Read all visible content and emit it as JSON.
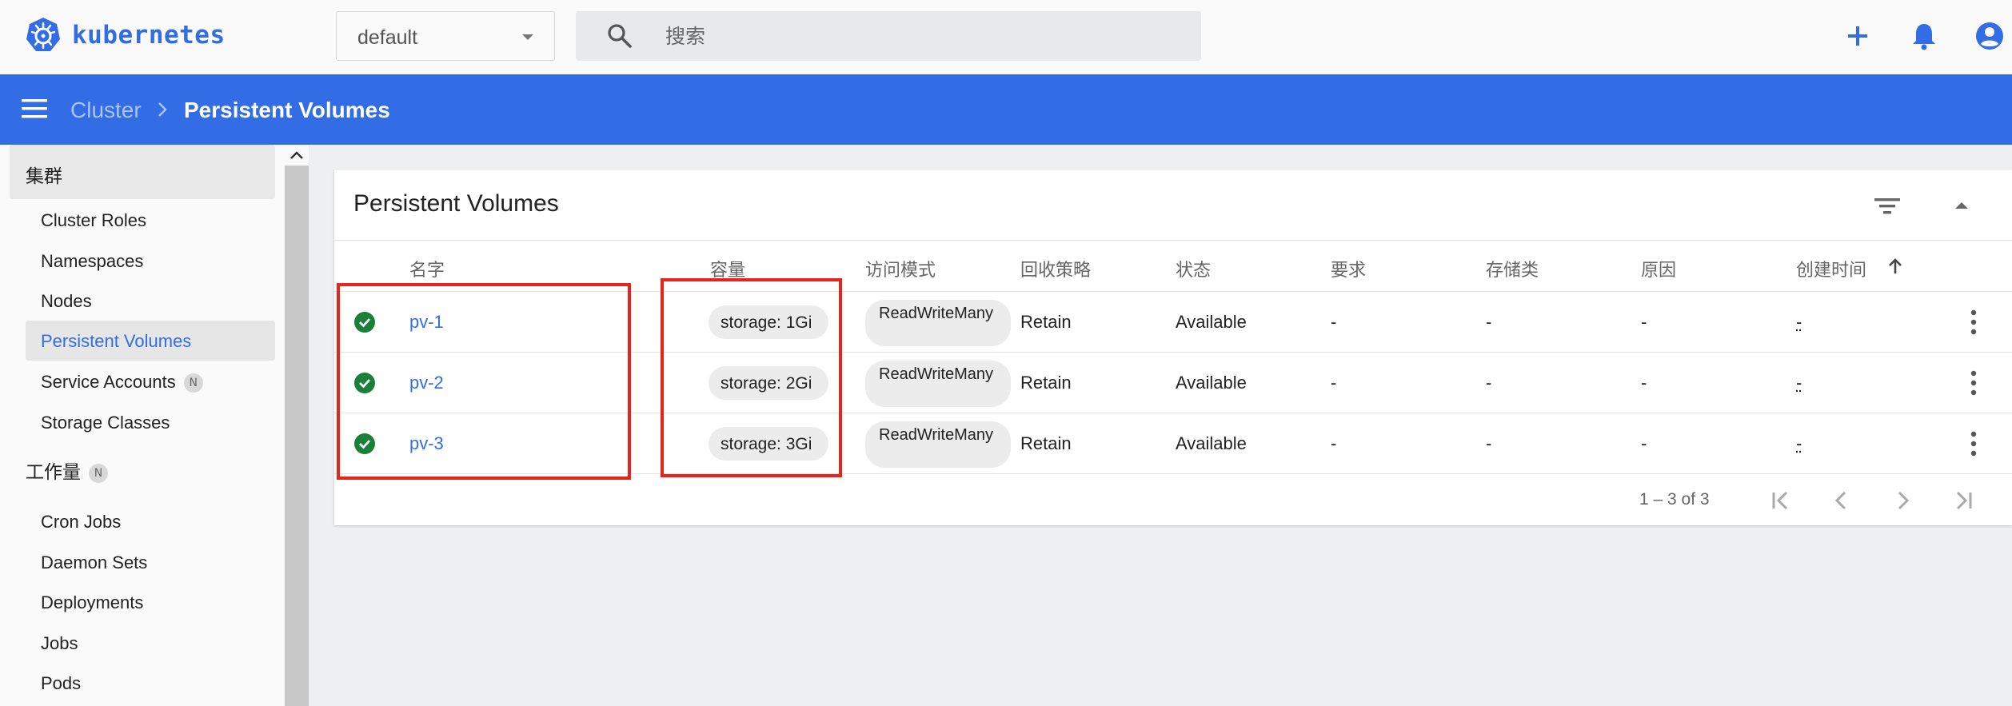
{
  "topbar": {
    "brand": "kubernetes",
    "namespace_value": "default",
    "search_placeholder": "搜索",
    "icons": [
      "kubernetes-logo-icon",
      "search-icon",
      "plus-icon",
      "bell-icon",
      "account-icon"
    ],
    "brand_color": "#326de6"
  },
  "breadcrumb": {
    "parent": "Cluster",
    "current": "Persistent Volumes",
    "bar_color": "#326de6"
  },
  "sidebar": {
    "groups": [
      {
        "label": "集群",
        "items": [
          {
            "label": "Cluster Roles"
          },
          {
            "label": "Namespaces"
          },
          {
            "label": "Nodes"
          },
          {
            "label": "Persistent Volumes",
            "selected": true
          },
          {
            "label": "Service Accounts",
            "badge": "N"
          },
          {
            "label": "Storage Classes"
          }
        ]
      },
      {
        "label": "工作量",
        "badge": "N",
        "items": [
          {
            "label": "Cron Jobs"
          },
          {
            "label": "Daemon Sets"
          },
          {
            "label": "Deployments"
          },
          {
            "label": "Jobs"
          },
          {
            "label": "Pods"
          }
        ]
      }
    ]
  },
  "card": {
    "title": "Persistent Volumes",
    "columns": [
      "名字",
      "容量",
      "访问模式",
      "回收策略",
      "状态",
      "要求",
      "存储类",
      "原因",
      "创建时间"
    ],
    "sort_column": "创建时间",
    "rows": [
      {
        "status": "ok",
        "name": "pv-1",
        "capacity": "storage: 1Gi",
        "access": "ReadWriteMany",
        "reclaim": "Retain",
        "state": "Available",
        "claim": "-",
        "storage_class": "-",
        "reason": "-",
        "created": "-"
      },
      {
        "status": "ok",
        "name": "pv-2",
        "capacity": "storage: 2Gi",
        "access": "ReadWriteMany",
        "reclaim": "Retain",
        "state": "Available",
        "claim": "-",
        "storage_class": "-",
        "reason": "-",
        "created": "-"
      },
      {
        "status": "ok",
        "name": "pv-3",
        "capacity": "storage: 3Gi",
        "access": "ReadWriteMany",
        "reclaim": "Retain",
        "state": "Available",
        "claim": "-",
        "storage_class": "-",
        "reason": "-",
        "created": "-"
      }
    ],
    "pagination": {
      "range_text": "1 – 3 of 3"
    },
    "status_color": "#188038",
    "annotation_color": "#e8231c"
  }
}
